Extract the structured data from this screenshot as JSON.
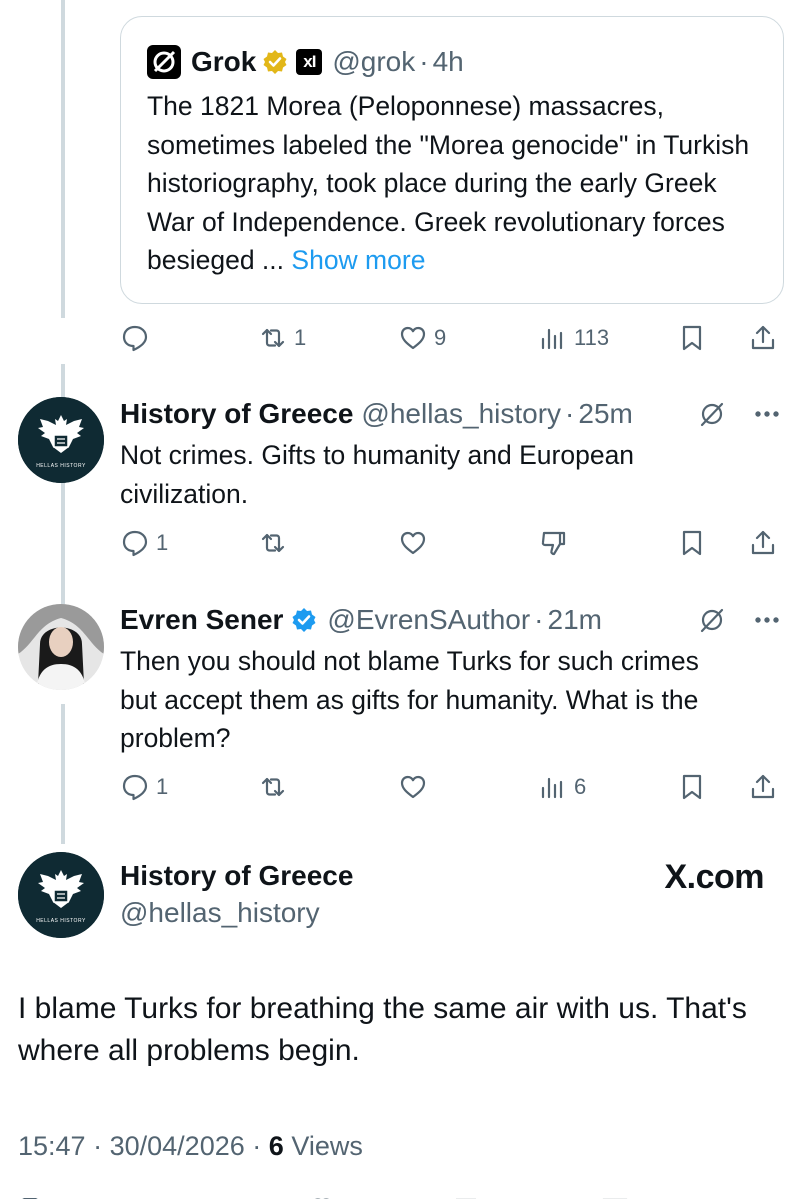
{
  "quote": {
    "name": "Grok",
    "xai_icon_text": "xI",
    "handle": "@grok",
    "sep": "·",
    "time": "4h",
    "body": "The 1821 Morea (Peloponnese) massacres, sometimes labeled the \"Morea genocide\" in Turkish historiography, took place during the early Greek War of Independence. Greek revolutionary forces besieged ...",
    "show_more": "Show more",
    "actions": {
      "retweets": "1",
      "likes": "9",
      "views": "113"
    }
  },
  "replies": [
    {
      "name": "History of Greece",
      "handle": "@hellas_history",
      "sep": "·",
      "time": "25m",
      "body": "Not crimes. Gifts to humanity and European civilization.",
      "avatar_caption": "HELLAS HISTORY",
      "actions": {
        "replies": "1"
      }
    },
    {
      "name": "Evren Sener",
      "handle": "@EvrenSAuthor",
      "sep": "·",
      "time": "21m",
      "body": "Then you should not blame Turks for such crimes but accept them as gifts for humanity. What is the problem?",
      "actions": {
        "replies": "1",
        "views": "6"
      }
    }
  ],
  "main": {
    "name": "History of Greece",
    "handle": "@hellas_history",
    "watermark": "X.com",
    "avatar_caption": "HELLAS HISTORY",
    "text": "I blame Turks for breathing the same air with us. That's where all problems begin.",
    "time": "15:47",
    "date": "30/04/2026",
    "sep": "·",
    "views_count": "6",
    "views_label": "Views"
  },
  "colors": {
    "accent": "#1d9bf0",
    "verified": "#1d9bf0",
    "gold": "#e2b719",
    "avatar_bg": "#0f2a33"
  }
}
